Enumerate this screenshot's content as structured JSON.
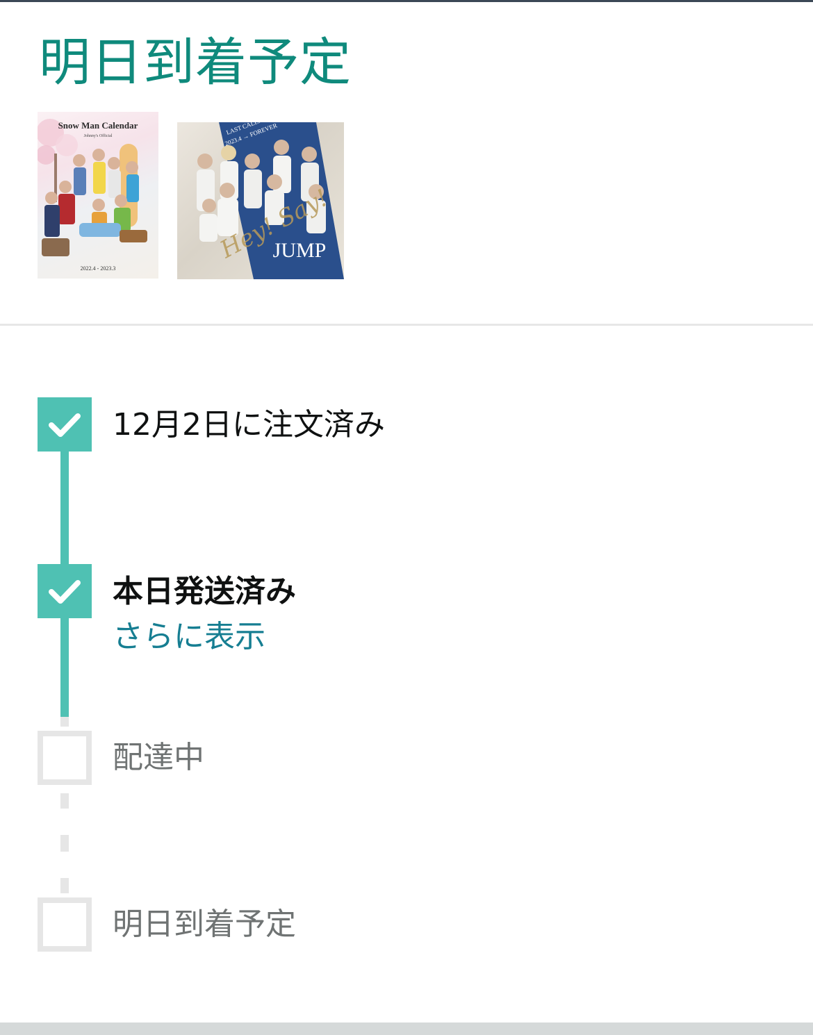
{
  "header": {
    "title": "明日到着予定"
  },
  "products": [
    {
      "cover_title": "Snow Man Calendar",
      "cover_subtitle": "Johnny's Official",
      "cover_dates": "2022.4 - 2023.3"
    },
    {
      "cover_title_line1": "LAST CALENDAR",
      "cover_title_line2": "2023.4 → FOREVER",
      "cover_logo_script": "Hey! Say!",
      "cover_logo": "JUMP"
    }
  ],
  "tracker": {
    "steps": [
      {
        "label": "12月2日に注文済み",
        "status": "complete"
      },
      {
        "label": "本日発送済み",
        "status": "complete",
        "link": "さらに表示"
      },
      {
        "label": "配達中",
        "status": "pending"
      },
      {
        "label": "明日到着予定",
        "status": "pending"
      }
    ]
  },
  "colors": {
    "title": "#0f8a7c",
    "progress": "#4fc1b3",
    "link": "#167e92",
    "pending": "#e6e6e6"
  }
}
